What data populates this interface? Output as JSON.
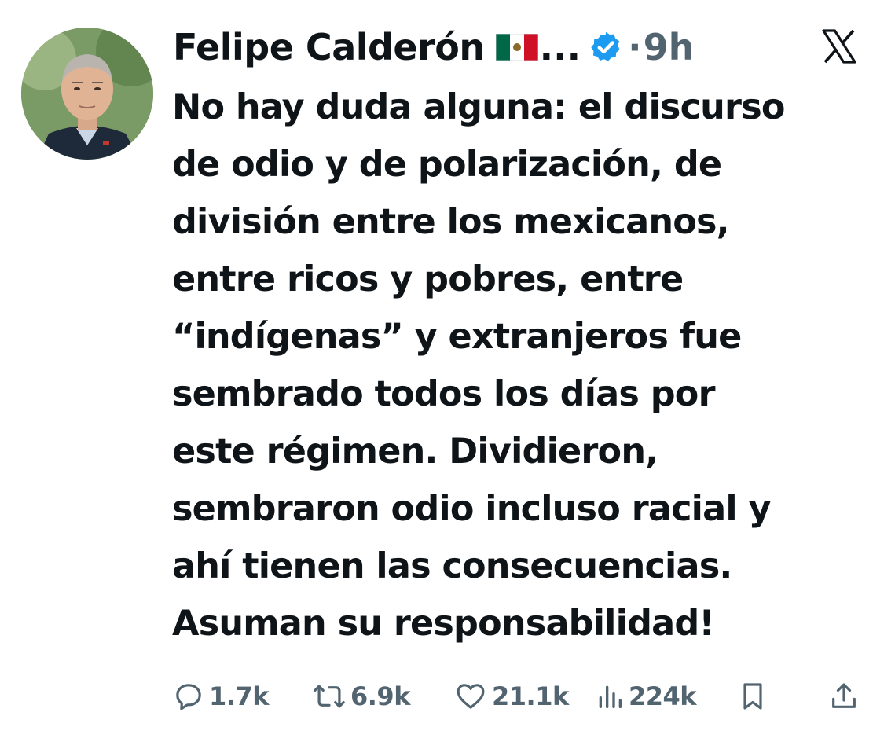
{
  "tweet": {
    "author_name": "Felipe Calderón",
    "flag": "mexico-flag",
    "ellipsis": "...",
    "separator": "·",
    "time": "9h",
    "platform_logo": "x-logo",
    "text": "No hay duda alguna: el discurso\nde odio y de polarización, de\ndivisión entre los mexicanos,\nentre ricos y pobres, entre\n“indígenas” y extranjeros fue\nsembrado todos los días por\neste régimen. Dividieron,\nsembraron odio incluso racial y\nahí tienen las consecuencias.\nAsuman su responsabilidad!"
  },
  "actions": {
    "replies": {
      "icon": "reply-icon",
      "count": "1.7k"
    },
    "reposts": {
      "icon": "repost-icon",
      "count": "6.9k"
    },
    "likes": {
      "icon": "heart-icon",
      "count": "21.1k"
    },
    "views": {
      "icon": "views-icon",
      "count": "224k"
    },
    "bookmark": {
      "icon": "bookmark-icon"
    },
    "share": {
      "icon": "share-icon"
    }
  },
  "colors": {
    "text": "#0f1419",
    "secondary": "#536471",
    "verified": "#1d9bf0"
  }
}
